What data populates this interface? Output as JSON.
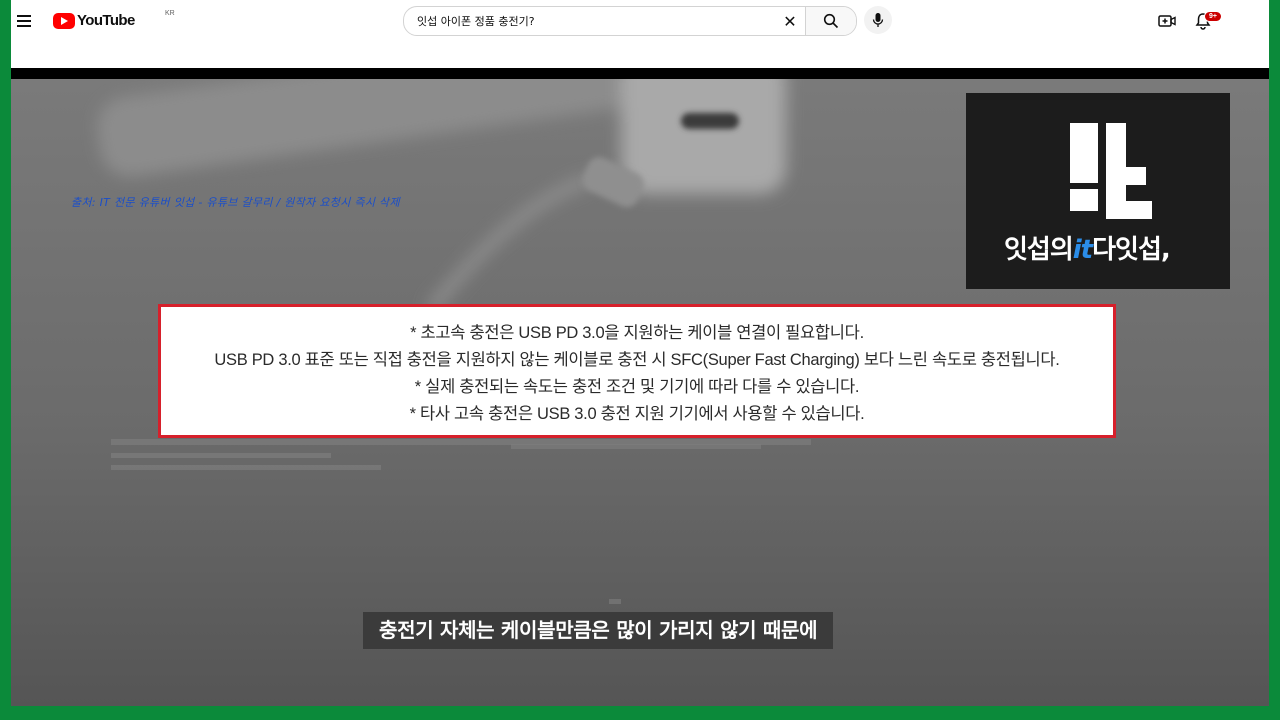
{
  "header": {
    "logo_word": "YouTube",
    "country_code": "KR",
    "search": {
      "value": "잇섭 아이폰 정품 충전기?"
    },
    "notifications_badge": "9+"
  },
  "icons": {
    "menu": "menu-icon",
    "clear": "close-icon",
    "search": "search-icon",
    "mic": "mic-icon",
    "create": "create-video-icon",
    "bell": "bell-icon"
  },
  "video": {
    "credit": "출처: IT 전문 유튜버 잇섭 - 유튜브 갈무리 / 원작자 요청시 즉시 삭제",
    "channel_logo": {
      "prefix": "잇섭의",
      "it": "it",
      "suffix": "다잇섭,"
    },
    "notice_lines": [
      "* 초고속 충전은 USB PD 3.0을 지원하는 케이블 연결이 필요합니다.",
      "USB PD 3.0 표준 또는 직접 충전을 지원하지 않는 케이블로 충전 시 SFC(Super Fast Charging) 보다 느린 속도로 충전됩니다.",
      "* 실제 충전되는 속도는 충전 조건 및 기기에 따라 다를 수 있습니다.",
      "* 타사 고속 충전은 USB 3.0 충전 지원 기기에서 사용할 수 있습니다."
    ],
    "subtitle": "충전기 자체는 케이블만큼은 많이 가리지 않기 때문에"
  },
  "colors": {
    "outer_frame": "#0b8a3a",
    "youtube_red": "#ff0000",
    "notice_border": "#d6202b",
    "credit_text": "#1a4ec9",
    "logo_accent": "#2b8de8"
  }
}
